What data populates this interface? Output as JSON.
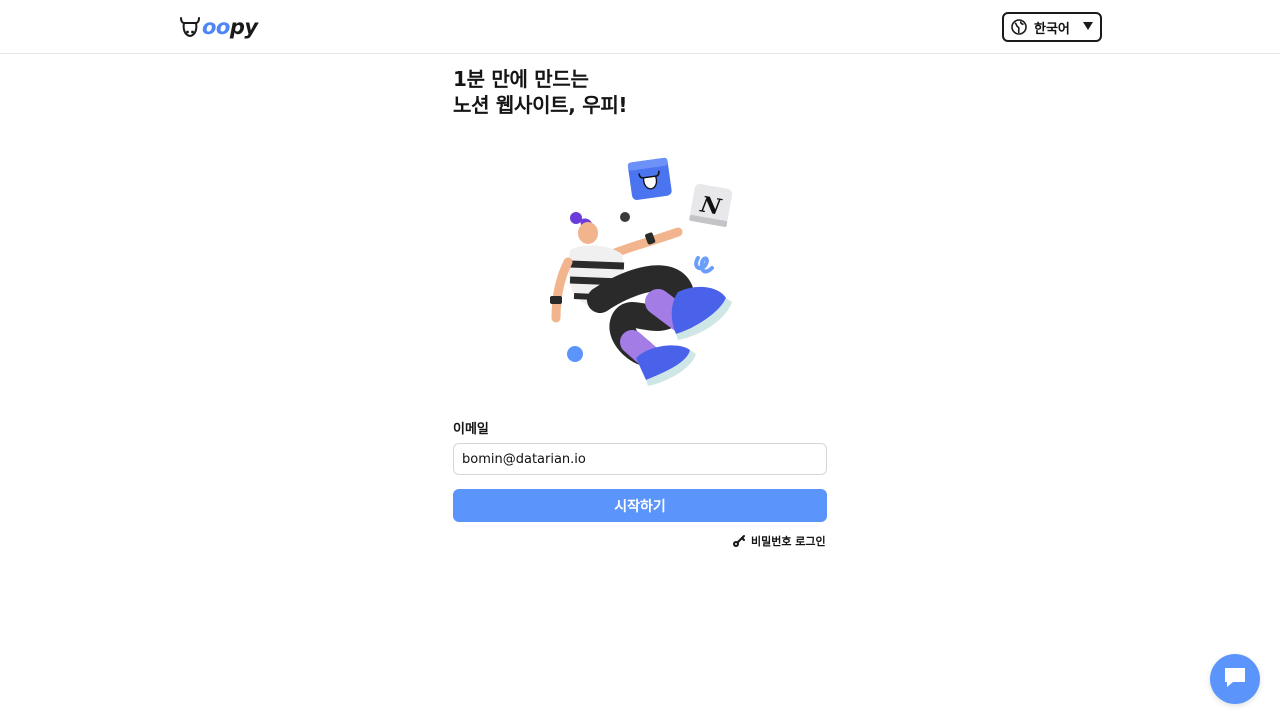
{
  "header": {
    "logo_text_colored": "oo",
    "logo_text_dark": "py",
    "logo_icon": "cow-head-icon",
    "language": {
      "label": "한국어",
      "icon": "globe-icon",
      "caret_icon": "caret-down-icon"
    }
  },
  "hero": {
    "headline_line1": "1분 만에 만드는",
    "headline_line2": "노션 웹사이트, 우피!",
    "illustration": "floating-person-illustration",
    "n_badge_text": "N"
  },
  "form": {
    "email_label": "이메일",
    "email_value": "bomin@datarian.io",
    "submit_label": "시작하기",
    "password_login_label": "비밀번호 로그인",
    "password_login_icon": "key-icon"
  },
  "chat": {
    "icon": "chat-bubble-icon"
  },
  "colors": {
    "accent": "#5b95fb",
    "logo_blue": "#4f86f7",
    "text_dark": "#151515",
    "border": "#d6d6d6"
  }
}
